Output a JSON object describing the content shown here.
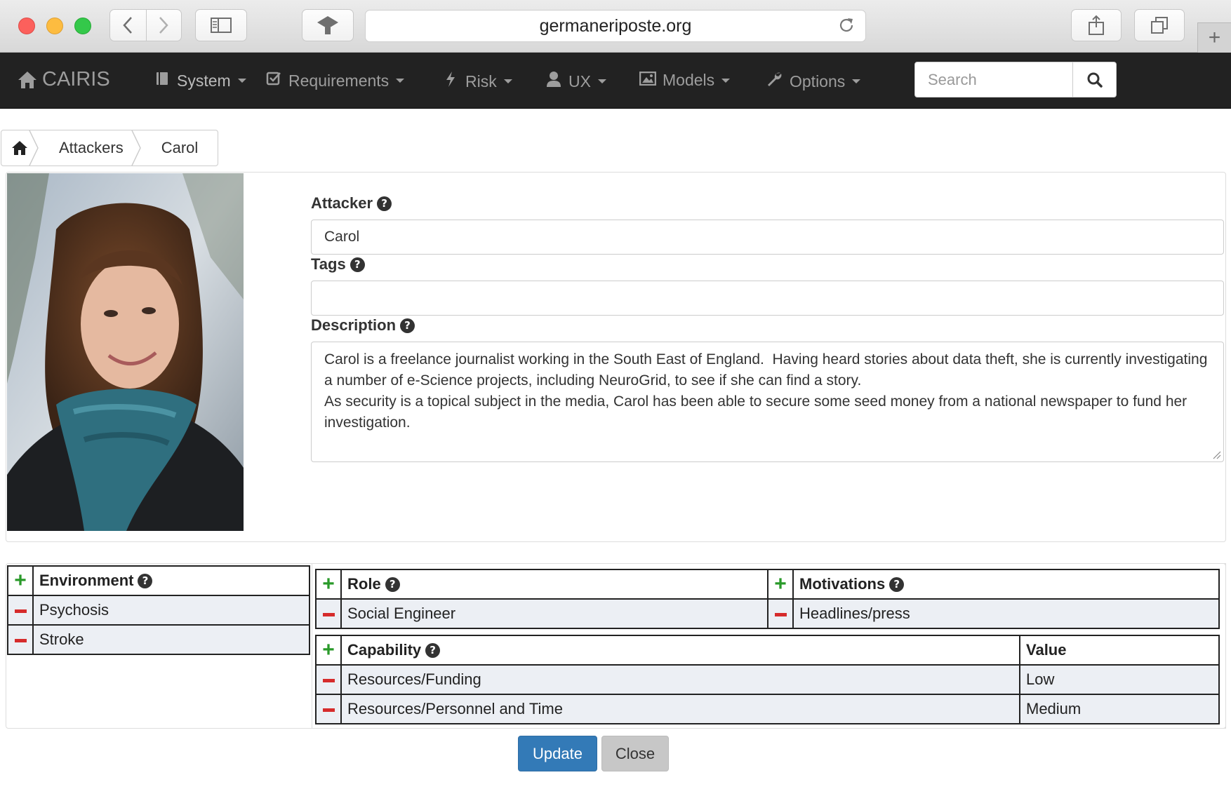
{
  "browser": {
    "url": "germaneriposte.org",
    "icons": [
      "back-icon",
      "forward-icon",
      "sidebar-icon",
      "extension-icon",
      "reload-icon",
      "share-icon",
      "tabs-icon",
      "new-tab-icon"
    ]
  },
  "navbar": {
    "brand": "CAIRIS",
    "items": [
      {
        "label": "System",
        "icon": "book-icon"
      },
      {
        "label": "Requirements",
        "icon": "check-square-icon"
      },
      {
        "label": "Risk",
        "icon": "bolt-icon"
      },
      {
        "label": "UX",
        "icon": "user-icon"
      },
      {
        "label": "Models",
        "icon": "picture-icon"
      },
      {
        "label": "Options",
        "icon": "wrench-icon"
      }
    ],
    "search": {
      "placeholder": "Search",
      "value": ""
    }
  },
  "breadcrumb": [
    "Attackers",
    "Carol"
  ],
  "form": {
    "attacker_label": "Attacker",
    "attacker_value": "Carol",
    "tags_label": "Tags",
    "tags_value": "",
    "description_label": "Description",
    "description_value": "Carol is a freelance journalist working in the South East of England.  Having heard stories about data theft, she is currently investigating a number of e-Science projects, including NeuroGrid, to see if she can find a story.\nAs security is a topical subject in the media, Carol has been able to secure some seed money from a national newspaper to fund her investigation."
  },
  "environments": {
    "header": "Environment",
    "rows": [
      "Psychosis",
      "Stroke"
    ]
  },
  "roles": {
    "header": "Role",
    "rows": [
      "Social Engineer"
    ]
  },
  "motivations": {
    "header": "Motivations",
    "rows": [
      "Headlines/press"
    ]
  },
  "capabilities": {
    "header": "Capability",
    "value_header": "Value",
    "rows": [
      {
        "name": "Resources/Funding",
        "value": "Low"
      },
      {
        "name": "Resources/Personnel and Time",
        "value": "Medium"
      }
    ]
  },
  "buttons": {
    "update": "Update",
    "close": "Close"
  },
  "colors": {
    "navbar": "#222222",
    "primary": "#337ab7",
    "add": "#2a9a2a",
    "remove": "#d62b2b",
    "row": "#eceff4"
  }
}
